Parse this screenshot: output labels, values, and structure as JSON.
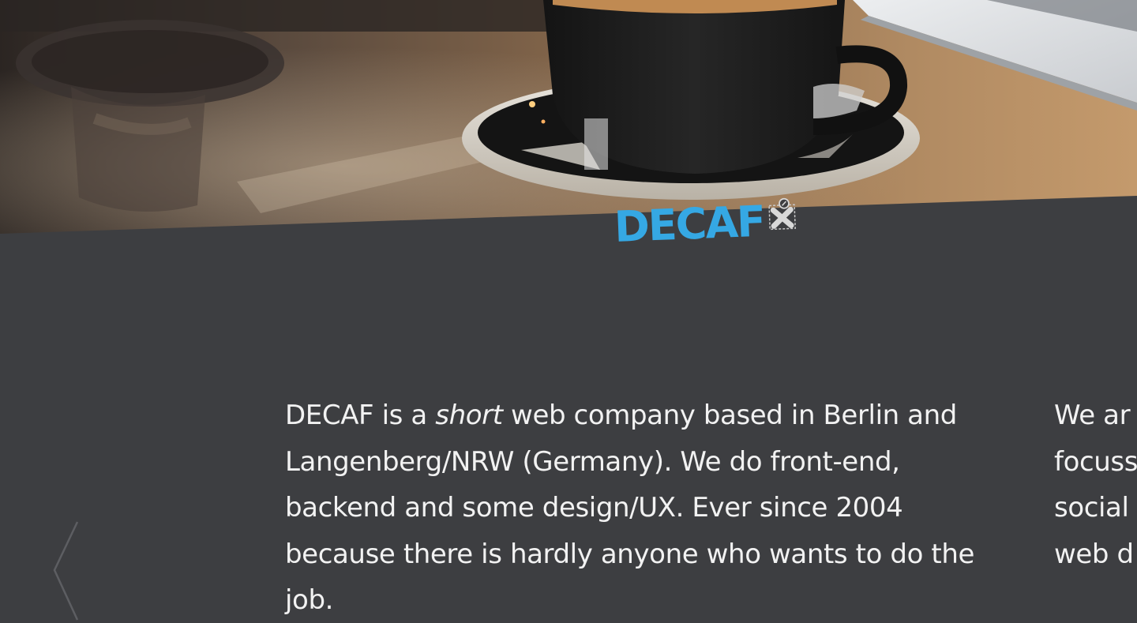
{
  "hero": {
    "image_icon": "coffee-cup-photo"
  },
  "logo": {
    "text": "DECAF",
    "color": "#35a8e4",
    "mark_icon": "plus-badge-icon"
  },
  "intro": {
    "before_em": "DECAF is a ",
    "em": "short",
    "after_em": " web company based in Berlin and Langenberg/NRW (Germany). We do front-end, backend and some design/UX. Ever since 2004 because there is hardly anyone who wants to do the job."
  },
  "intro_next": {
    "lines": [
      "We ar",
      "focuss",
      "social",
      "web d"
    ]
  },
  "nav": {
    "prev_icon": "chevron-left-icon"
  },
  "colors": {
    "background": "#3d3e41",
    "text": "#f2f2f2",
    "accent": "#35a8e4"
  }
}
